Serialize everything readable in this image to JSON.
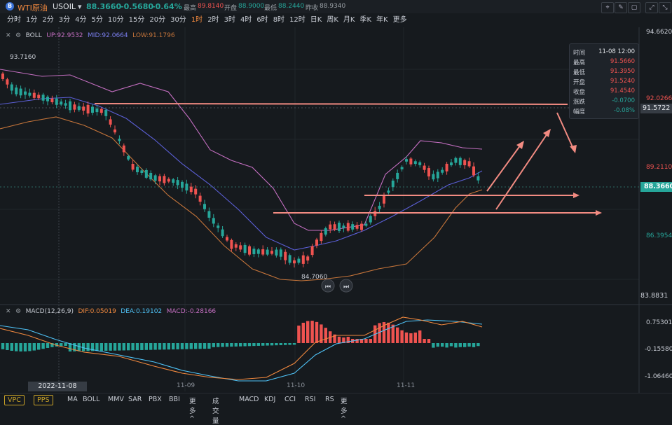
{
  "header": {
    "logo_letter": "B",
    "symbol_name": "WTI原油",
    "symbol_code": "USOIL",
    "dropdown_arrow": "▾",
    "price": "88.3660",
    "change": "-0.5680",
    "change_pct": "-0.64%",
    "high_label": "最高",
    "high": "89.8140",
    "open_label": "开盘",
    "open": "88.9000",
    "low_label": "最低",
    "low": "88.2440",
    "prev_close_label": "昨收",
    "prev_close": "88.9340"
  },
  "timeframes": [
    "分时",
    "1分",
    "2分",
    "3分",
    "4分",
    "5分",
    "10分",
    "15分",
    "20分",
    "30分",
    "1时",
    "2时",
    "3时",
    "4时",
    "6时",
    "8时",
    "12时",
    "日K",
    "周K",
    "月K",
    "季K",
    "年K",
    "更多"
  ],
  "active_timeframe": "1时",
  "boll": {
    "label": "BOLL",
    "up": "UP:92.9532",
    "mid": "MID:92.0664",
    "low": "LOW:91.1796"
  },
  "macd": {
    "label": "MACD(12,26,9)",
    "dif": "DIF:0.05019",
    "dea": "DEA:0.19102",
    "macd": "MACD:-0.28166"
  },
  "price_axis": {
    "top": "94.6620",
    "p92": "92.0266",
    "p91": "91.5722",
    "p89": "89.2110",
    "current": "88.3660",
    "p86": "86.3954",
    "bottom": "83.8831"
  },
  "macd_axis": {
    "a1": "0.75301",
    "a2": "-0.15580",
    "a3": "-1.06460"
  },
  "annotations": {
    "high_mark": "93.7160",
    "low_mark": "84.7060"
  },
  "tooltip": {
    "time_label": "时间",
    "time": "11-08 12:00",
    "high_label": "最高",
    "high": "91.5660",
    "low_label": "最低",
    "low": "91.3950",
    "open_label": "开盘",
    "open": "91.5240",
    "close_label": "收盘",
    "close": "91.4540",
    "chg_label": "涨跌",
    "chg": "-0.0700",
    "amp_label": "幅度",
    "amp": "-0.08%"
  },
  "time_axis": {
    "cursor_time": "2022-11-08 12:00",
    "t1": "11-09",
    "t2": "11-10",
    "t3": "11-11"
  },
  "bottom_bar": {
    "vpc": "VPC",
    "pps": "PPS",
    "main_indicators": [
      "MA",
      "BOLL",
      "MMV",
      "SAR",
      "PBX",
      "BBI",
      "更多 ^"
    ],
    "sub_indicators": [
      "成交量",
      "MACD",
      "KDJ",
      "CCI",
      "RSI",
      "RS",
      "更多 ^"
    ]
  },
  "colors": {
    "up": "#ef5350",
    "down": "#26a69a",
    "boll_up": "#c56fc2",
    "boll_mid": "#5b5fd6",
    "boll_low": "#c4743a",
    "accent": "#f0883e",
    "drawing": "#f28b82"
  },
  "icons": {
    "collapse": "close-x-icon",
    "settings": "gear-icon",
    "tools": [
      "crosshair-icon",
      "pen-icon",
      "square-icon",
      "expand-icon"
    ]
  }
}
